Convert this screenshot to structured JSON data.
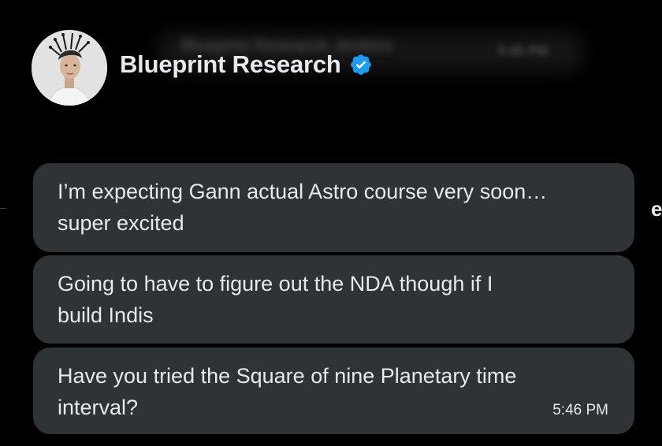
{
  "header": {
    "blurred_text": "Blueprint Research Jenkins",
    "blurred_time": "5:45 PM",
    "name": "Blueprint Research",
    "verified": true,
    "verified_icon": "verified-badge-icon",
    "avatar_icon": "avatar-portrait"
  },
  "messages": [
    {
      "text_line1": "I’m expecting Gann actual Astro course very soon…",
      "text_line2": "super excited"
    },
    {
      "text_line1": "Going to have to figure out the NDA though if I",
      "text_line2": "build Indis"
    },
    {
      "text_line1": "Have you tried the Square of nine Planetary time",
      "text_line2": "interval?",
      "time": "5:46 PM"
    }
  ],
  "colors": {
    "background": "#000000",
    "bubble": "#2f3336",
    "text": "#e7e9ea",
    "verified": "#1d9bf0"
  }
}
